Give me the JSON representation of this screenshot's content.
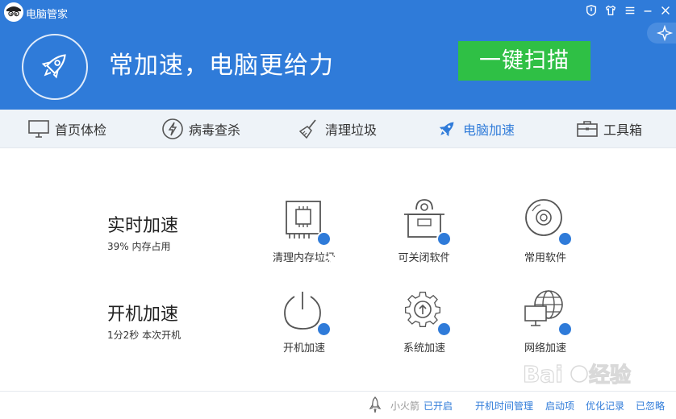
{
  "window": {
    "title": "电脑管家",
    "controls": [
      "shield-icon",
      "shirt-icon",
      "menu-icon",
      "minimize-icon",
      "close-icon"
    ]
  },
  "hero": {
    "headline": "常加速，电脑更给力",
    "scan_button": "一键扫描",
    "colors": {
      "banner": "#2f7bd9",
      "scan_button": "#2fc045"
    }
  },
  "nav": {
    "items": [
      {
        "label": "首页体检",
        "icon": "monitor-icon"
      },
      {
        "label": "病毒查杀",
        "icon": "lightning-icon"
      },
      {
        "label": "清理垃圾",
        "icon": "broom-icon"
      },
      {
        "label": "电脑加速",
        "icon": "rocket-icon",
        "active": true
      },
      {
        "label": "工具箱",
        "icon": "toolbox-icon"
      }
    ]
  },
  "sections": [
    {
      "title": "实时加速",
      "subtitle": "39% 内存占用",
      "features": [
        {
          "label": "清理内存垃圾",
          "icon": "memory-chip-icon",
          "checked": true
        },
        {
          "label": "可关闭软件",
          "icon": "box-icon",
          "checked": true
        },
        {
          "label": "常用软件",
          "icon": "disc-icon",
          "checked": true
        }
      ]
    },
    {
      "title": "开机加速",
      "subtitle": "1分2秒 本次开机",
      "features": [
        {
          "label": "开机加速",
          "icon": "power-icon",
          "checked": true
        },
        {
          "label": "系统加速",
          "icon": "gear-arrow-icon",
          "checked": true
        },
        {
          "label": "网络加速",
          "icon": "globe-monitor-icon",
          "checked": true
        }
      ]
    }
  ],
  "footer": {
    "rocket_label": "小火箭",
    "rocket_status": "已开启",
    "links": [
      "开机时间管理",
      "启动项",
      "优化记录",
      "已忽略"
    ]
  }
}
